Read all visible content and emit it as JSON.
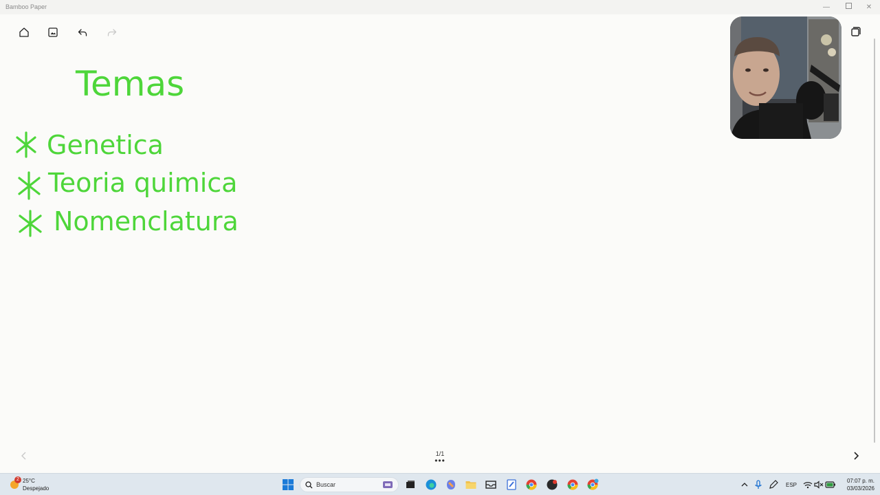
{
  "window": {
    "title": "Bamboo Paper"
  },
  "toolbar": {
    "icons": [
      "home-icon",
      "image-insert-icon",
      "undo-icon",
      "redo-icon"
    ]
  },
  "canvas": {
    "ink_color": "#4ed63a",
    "heading": "Temas",
    "items": [
      "Genetica",
      "Teoria quimica",
      "Nomenclatura"
    ]
  },
  "pagination": {
    "page_counter": "1/1"
  },
  "taskbar": {
    "weather": {
      "temperature": "25°C",
      "condition": "Despejado",
      "badge": "2"
    },
    "search_label": "Buscar",
    "tray": {
      "language": "ESP",
      "time": "07:07 p. m.",
      "date": "03/03/2026"
    }
  }
}
